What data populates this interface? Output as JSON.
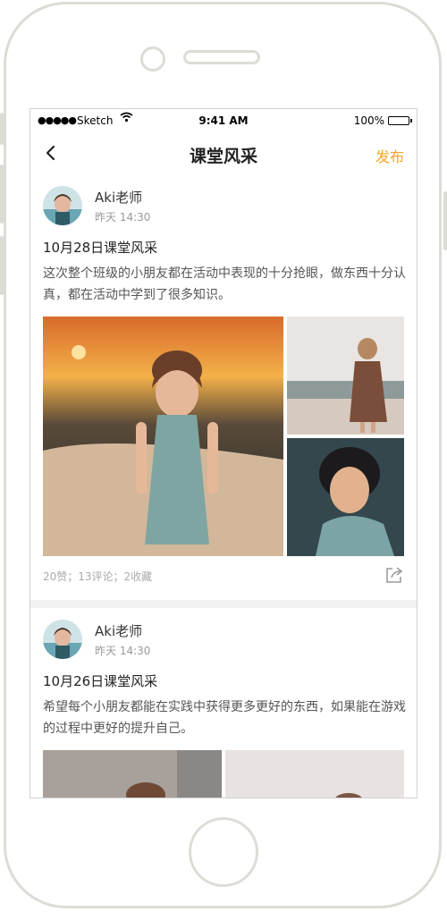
{
  "status_bar": {
    "signal": "●●●●●",
    "carrier": "Sketch",
    "time": "9:41 AM",
    "battery": "100%"
  },
  "nav": {
    "back_icon": "chevron-left-icon",
    "title": "课堂风采",
    "action": "发布"
  },
  "posts": [
    {
      "author": "Aki老师",
      "time": "昨天 14:30",
      "title": "10月28日课堂风采",
      "body": "这次整个班级的小朋友都在活动中表现的十分抢眼，做东西十分认真，都在活动中学到了很多知识。",
      "stats": "20赞；13评论；2收藏"
    },
    {
      "author": "Aki老师",
      "time": "昨天 14:30",
      "title": "10月26日课堂风采",
      "body": "希望每个小朋友都能在实践中获得更多更好的东西，如果能在游戏的过程中更好的提升自己。"
    }
  ],
  "colors": {
    "accent": "#f5a623",
    "divider": "#f2f2f2",
    "frame": "#dcdcd6"
  }
}
